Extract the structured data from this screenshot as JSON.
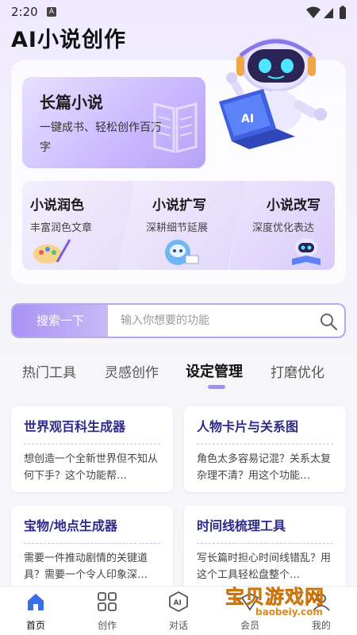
{
  "status": {
    "time": "2:20",
    "a_badge": "A"
  },
  "app": {
    "title": "AI小说创作"
  },
  "hero": {
    "long_card": {
      "title": "长篇小说",
      "subtitle": "一键成书、轻松创作百万字"
    },
    "small_cards": [
      {
        "title": "小说润色",
        "subtitle": "丰富润色文章"
      },
      {
        "title": "小说扩写",
        "subtitle": "深耕细节延展"
      },
      {
        "title": "小说改写",
        "subtitle": "深度优化表达"
      }
    ],
    "robot_screen_label": "AI"
  },
  "search": {
    "button_label": "搜索一下",
    "placeholder": "输入你想要的功能",
    "value": ""
  },
  "tabs": [
    {
      "label": "热门工具"
    },
    {
      "label": "灵感创作"
    },
    {
      "label": "设定管理"
    },
    {
      "label": "打磨优化"
    }
  ],
  "active_tab": "设定管理",
  "tools": [
    {
      "title": "世界观百科生成器",
      "desc": "想创造一个全新世界但不知从何下手？这个功能帮…"
    },
    {
      "title": "人物卡片与关系图",
      "desc": "角色太多容易记混？关系太复杂理不清？用这个功能…"
    },
    {
      "title": "宝物/地点生成器",
      "desc": "需要一件推动剧情的关键道具？需要一个令人印象深…"
    },
    {
      "title": "时间线梳理工具",
      "desc": "写长篇时担心时间线错乱？用这个工具轻松盘整个…"
    }
  ],
  "nav": [
    {
      "label": "首页",
      "icon": "home-icon"
    },
    {
      "label": "创作",
      "icon": "grid-icon"
    },
    {
      "label": "对话",
      "icon": "ai-chat-icon"
    },
    {
      "label": "会员",
      "icon": "member-icon"
    },
    {
      "label": "我的",
      "icon": "profile-icon"
    }
  ],
  "watermark": {
    "text": "宝贝游戏网",
    "url": "baobeiy.com"
  },
  "colors": {
    "accent": "#a48df0",
    "tool_title": "#2d2a8c",
    "home_active": "#3a6ee8",
    "watermark": "#f4a22c"
  }
}
